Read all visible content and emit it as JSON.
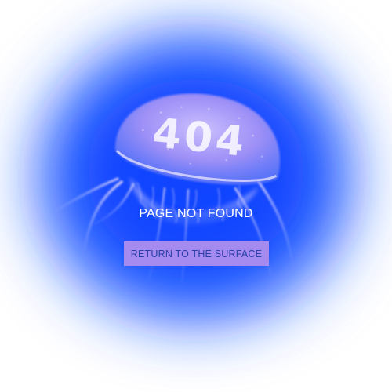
{
  "error": {
    "code": "404",
    "message": "PAGE NOT FOUND"
  },
  "actions": {
    "return_label": "RETURN TO THE SURFACE"
  },
  "colors": {
    "ocean_blue": "#1a5cff",
    "button_bg": "#a58af0",
    "button_text": "#2a3fa8",
    "text": "#ffffff"
  },
  "illustration": {
    "subject": "jellyfish-illustration"
  }
}
